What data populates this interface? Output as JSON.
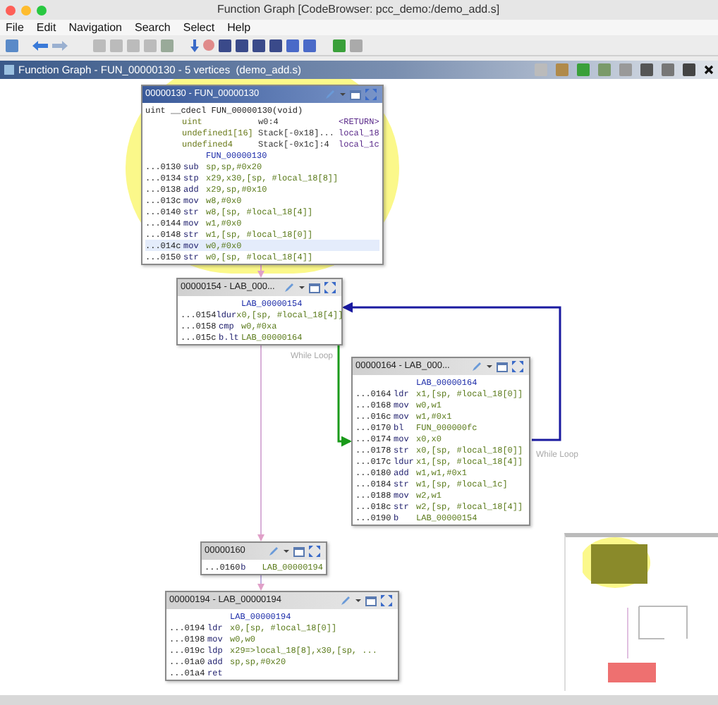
{
  "window": {
    "title": "Function Graph [CodeBrowser: pcc_demo:/demo_add.s]"
  },
  "menu": [
    "File",
    "Edit",
    "Navigation",
    "Search",
    "Select",
    "Help"
  ],
  "panel": {
    "title": "Function Graph - FUN_00000130 - 5 vertices  (demo_add.s)"
  },
  "graph": {
    "nodes": [
      {
        "title": "00000130 - FUN_00000130",
        "selected": true,
        "lines": [
          {
            "kind": "signature",
            "text": "uint __cdecl FUN_00000130(void)",
            "highlighted": false
          },
          {
            "kind": "var",
            "type": "uint",
            "storage": "w0:4",
            "name": "<RETURN>",
            "highlighted": false
          },
          {
            "kind": "var",
            "type": "undefined1[16]",
            "storage": "Stack[-0x18]...",
            "name": "local_18",
            "highlighted": false
          },
          {
            "kind": "var",
            "type": "undefined4",
            "storage": "Stack[-0x1c]:4",
            "name": "local_1c",
            "highlighted": false
          },
          {
            "kind": "label",
            "text": "FUN_00000130",
            "highlighted": false
          },
          {
            "kind": "insn",
            "address": "...0130",
            "mnemonic": "sub",
            "operands": "sp,sp,#0x20",
            "highlighted": false
          },
          {
            "kind": "insn",
            "address": "...0134",
            "mnemonic": "stp",
            "operands": "x29,x30,[sp, #local_18[8]]",
            "highlighted": false
          },
          {
            "kind": "insn",
            "address": "...0138",
            "mnemonic": "add",
            "operands": "x29,sp,#0x10",
            "highlighted": false
          },
          {
            "kind": "insn",
            "address": "...013c",
            "mnemonic": "mov",
            "operands": "w8,#0x0",
            "highlighted": false
          },
          {
            "kind": "insn",
            "address": "...0140",
            "mnemonic": "str",
            "operands": "w8,[sp, #local_18[4]]",
            "highlighted": false
          },
          {
            "kind": "insn",
            "address": "...0144",
            "mnemonic": "mov",
            "operands": "w1,#0x0",
            "highlighted": false
          },
          {
            "kind": "insn",
            "address": "...0148",
            "mnemonic": "str",
            "operands": "w1,[sp, #local_18[0]]",
            "highlighted": false
          },
          {
            "kind": "insn",
            "address": "...014c",
            "mnemonic": "mov",
            "operands": "w0,#0x0",
            "highlighted": true
          },
          {
            "kind": "insn",
            "address": "...0150",
            "mnemonic": "str",
            "operands": "w0,[sp, #local_18[4]]",
            "highlighted": false
          }
        ]
      },
      {
        "title": "00000154 - LAB_000...",
        "selected": false,
        "lines": [
          {
            "kind": "label",
            "text": "LAB_00000154",
            "highlighted": false
          },
          {
            "kind": "insn",
            "address": "...0154",
            "mnemonic": "ldur",
            "operands": "x0,[sp, #local_18[4]]",
            "highlighted": false
          },
          {
            "kind": "insn",
            "address": "...0158",
            "mnemonic": "cmp",
            "operands": "w0,#0xa",
            "highlighted": false
          },
          {
            "kind": "insn",
            "address": "...015c",
            "mnemonic": "b.lt",
            "operands": "LAB_00000164",
            "highlighted": false
          }
        ]
      },
      {
        "title": "00000164 - LAB_000...",
        "selected": false,
        "lines": [
          {
            "kind": "label",
            "text": "LAB_00000164",
            "highlighted": false
          },
          {
            "kind": "insn",
            "address": "...0164",
            "mnemonic": "ldr",
            "operands": "x1,[sp, #local_18[0]]",
            "highlighted": false
          },
          {
            "kind": "insn",
            "address": "...0168",
            "mnemonic": "mov",
            "operands": "w0,w1",
            "highlighted": false
          },
          {
            "kind": "insn",
            "address": "...016c",
            "mnemonic": "mov",
            "operands": "w1,#0x1",
            "highlighted": false
          },
          {
            "kind": "insn",
            "address": "...0170",
            "mnemonic": "bl",
            "operands": "FUN_000000fc",
            "highlighted": false
          },
          {
            "kind": "insn",
            "address": "...0174",
            "mnemonic": "mov",
            "operands": "x0,x0",
            "highlighted": false
          },
          {
            "kind": "insn",
            "address": "...0178",
            "mnemonic": "str",
            "operands": "x0,[sp, #local_18[0]]",
            "highlighted": false
          },
          {
            "kind": "insn",
            "address": "...017c",
            "mnemonic": "ldur",
            "operands": "x1,[sp, #local_18[4]]",
            "highlighted": false
          },
          {
            "kind": "insn",
            "address": "...0180",
            "mnemonic": "add",
            "operands": "w1,w1,#0x1",
            "highlighted": false
          },
          {
            "kind": "insn",
            "address": "...0184",
            "mnemonic": "str",
            "operands": "w1,[sp, #local_1c]",
            "highlighted": false
          },
          {
            "kind": "insn",
            "address": "...0188",
            "mnemonic": "mov",
            "operands": "w2,w1",
            "highlighted": false
          },
          {
            "kind": "insn",
            "address": "...018c",
            "mnemonic": "str",
            "operands": "w2,[sp, #local_18[4]]",
            "highlighted": false
          },
          {
            "kind": "insn",
            "address": "...0190",
            "mnemonic": "b",
            "operands": "LAB_00000154",
            "highlighted": false
          }
        ]
      },
      {
        "title": "00000160",
        "selected": false,
        "lines": [
          {
            "kind": "insn",
            "address": "...0160",
            "mnemonic": "b",
            "operands": "LAB_00000194",
            "highlighted": false
          }
        ]
      },
      {
        "title": "00000194 - LAB_00000194",
        "selected": false,
        "lines": [
          {
            "kind": "label",
            "text": "LAB_00000194",
            "highlighted": false
          },
          {
            "kind": "insn",
            "address": "...0194",
            "mnemonic": "ldr",
            "operands": "x0,[sp, #local_18[0]]",
            "highlighted": false
          },
          {
            "kind": "insn",
            "address": "...0198",
            "mnemonic": "mov",
            "operands": "w0,w0",
            "highlighted": false
          },
          {
            "kind": "insn",
            "address": "...019c",
            "mnemonic": "ldp",
            "operands": "x29=>local_18[8],x30,[sp, ...",
            "highlighted": false
          },
          {
            "kind": "insn",
            "address": "...01a0",
            "mnemonic": "add",
            "operands": "sp,sp,#0x20",
            "highlighted": false
          },
          {
            "kind": "insn",
            "address": "...01a4",
            "mnemonic": "ret",
            "highlighted": false
          }
        ]
      }
    ],
    "edge_labels": [
      "While Loop",
      "While Loop"
    ]
  }
}
